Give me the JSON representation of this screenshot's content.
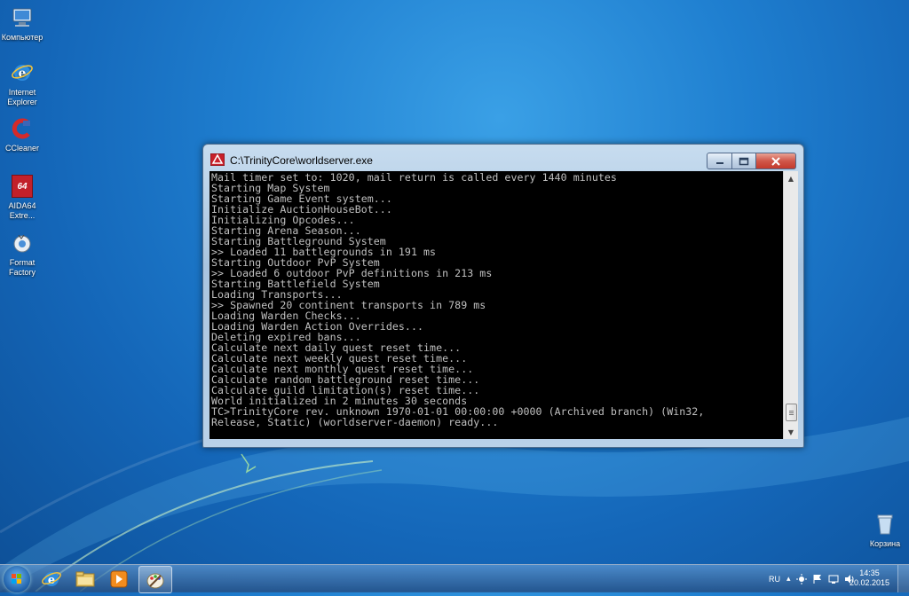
{
  "desktop": {
    "icons": [
      {
        "label_line1": "Компьютер",
        "label_line2": ""
      },
      {
        "label_line1": "Internet",
        "label_line2": "Explorer"
      },
      {
        "label_line1": "CCleaner",
        "label_line2": ""
      },
      {
        "label_line1": "AIDA64",
        "label_line2": "Extre..."
      },
      {
        "label_line1": "Format",
        "label_line2": "Factory"
      },
      {
        "label_line1": "Корзина",
        "label_line2": ""
      }
    ],
    "aida_badge": "64"
  },
  "window": {
    "title": "C:\\TrinityCore\\worldserver.exe",
    "lines": [
      "Mail timer set to: 1020, mail return is called every 1440 minutes",
      "Starting Map System",
      "Starting Game Event system...",
      "Initialize AuctionHouseBot...",
      "Initializing Opcodes...",
      "Starting Arena Season...",
      "Starting Battleground System",
      ">> Loaded 11 battlegrounds in 191 ms",
      "Starting Outdoor PvP System",
      ">> Loaded 6 outdoor PvP definitions in 213 ms",
      "Starting Battlefield System",
      "Loading Transports...",
      ">> Spawned 20 continent transports in 789 ms",
      "Loading Warden Checks...",
      "Loading Warden Action Overrides...",
      "Deleting expired bans...",
      "Calculate next daily quest reset time...",
      "Calculate next weekly quest reset time...",
      "Calculate next monthly quest reset time...",
      "Calculate random battleground reset time...",
      "Calculate guild limitation(s) reset time...",
      "World initialized in 2 minutes 30 seconds",
      "TC>TrinityCore rev. unknown 1970-01-01 00:00:00 +0000 (Archived branch) (Win32,",
      "Release, Static) (worldserver-daemon) ready..."
    ]
  },
  "taskbar": {
    "language": "RU",
    "time": "14:35",
    "date": "20.02.2015"
  }
}
